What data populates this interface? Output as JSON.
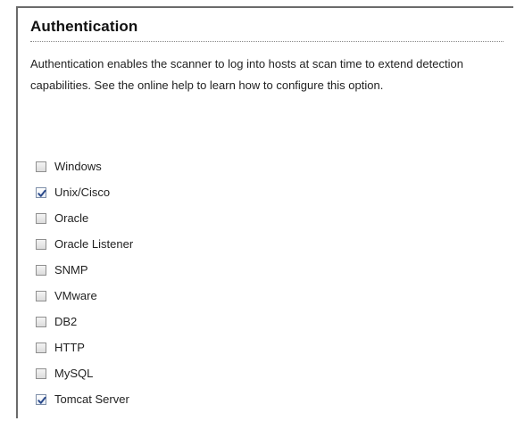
{
  "section": {
    "title": "Authentication",
    "description": "Authentication enables the scanner to log into hosts at scan time to extend detection capabilities. See the online help to learn how to configure this option."
  },
  "options": [
    {
      "label": "Windows",
      "checked": false
    },
    {
      "label": "Unix/Cisco",
      "checked": true
    },
    {
      "label": "Oracle",
      "checked": false
    },
    {
      "label": "Oracle Listener",
      "checked": false
    },
    {
      "label": "SNMP",
      "checked": false
    },
    {
      "label": "VMware",
      "checked": false
    },
    {
      "label": "DB2",
      "checked": false
    },
    {
      "label": "HTTP",
      "checked": false
    },
    {
      "label": "MySQL",
      "checked": false
    },
    {
      "label": "Tomcat Server",
      "checked": true
    }
  ],
  "colors": {
    "check_mark": "#2b4a8b",
    "border": "#6b6b6b"
  }
}
